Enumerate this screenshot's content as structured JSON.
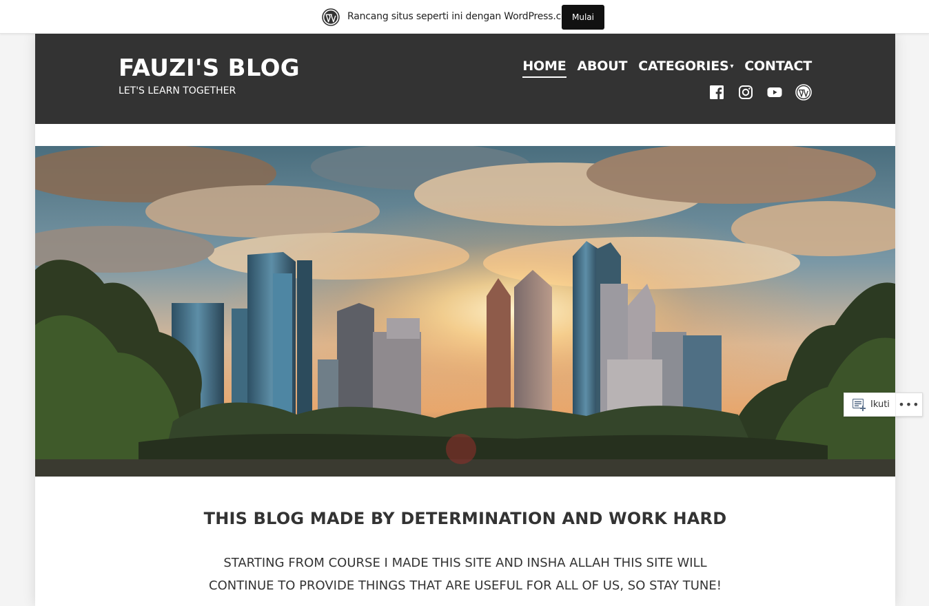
{
  "wp_banner": {
    "text": "Rancang situs seperti ini dengan WordPress.com",
    "button_label": "Mulai"
  },
  "site": {
    "title": "FAUZI'S BLOG",
    "tagline": "LET'S LEARN TOGETHER"
  },
  "nav": {
    "items": [
      {
        "label": "HOME",
        "active": true
      },
      {
        "label": "ABOUT",
        "active": false
      },
      {
        "label": "CATEGORIES",
        "active": false,
        "has_dropdown": true
      },
      {
        "label": "CONTACT",
        "active": false
      }
    ],
    "dropdown_caret": "▾"
  },
  "social": {
    "icons": [
      "facebook-icon",
      "instagram-icon",
      "youtube-icon",
      "wordpress-icon"
    ]
  },
  "follow_widget": {
    "follow_label": "Ikuti",
    "more_label": "•••"
  },
  "content": {
    "heading": "THIS BLOG MADE BY DETERMINATION AND WORK HARD",
    "body": "STARTING FROM COURSE I MADE THIS SITE AND INSHA ALLAH THIS SITE WILL CONTINUE TO PROVIDE THINGS THAT ARE USEFUL FOR ALL OF US, SO STAY TUNE!"
  },
  "colors": {
    "header_bg": "#333333",
    "page_bg": "#f4f4f4",
    "button_bg": "#111111",
    "text": "#333333"
  }
}
